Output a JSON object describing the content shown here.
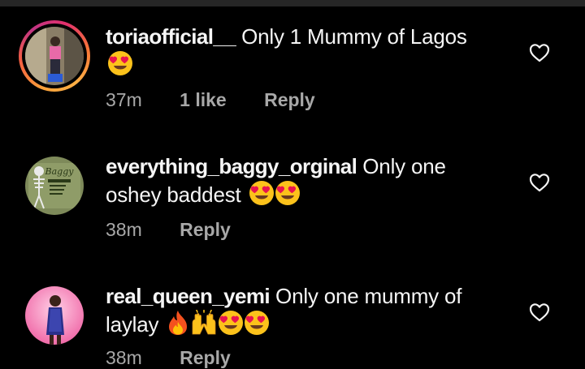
{
  "comments": [
    {
      "username": "toriaofficial__",
      "text_line1": "Only 1 Mummy of Lagos",
      "text_line2": "",
      "emojis": [
        "heart-eyes"
      ],
      "time": "37m",
      "likes": "1 like",
      "reply": "Reply",
      "has_story_ring": true
    },
    {
      "username": "everything_baggy_orginal",
      "text_line1": "Only one",
      "text_line2": "oshey baddest",
      "emojis": [
        "heart-eyes",
        "heart-eyes"
      ],
      "time": "38m",
      "likes": "",
      "reply": "Reply",
      "has_story_ring": false,
      "avatar_logo_text": "Baggy"
    },
    {
      "username": "real_queen_yemi",
      "text_line1": "Only one mummy of",
      "text_line2": "laylay",
      "emojis": [
        "fire",
        "raised-hands",
        "heart-eyes",
        "heart-eyes"
      ],
      "time": "38m",
      "likes": "",
      "reply": "Reply",
      "has_story_ring": false
    }
  ],
  "colors": {
    "background": "#000000",
    "text": "#f5f5f5",
    "meta": "#a8a8a8",
    "emoji_face": "#fcc21b",
    "emoji_heart": "#e8134f",
    "fire_outer": "#f4511e",
    "fire_inner": "#ffc107"
  }
}
